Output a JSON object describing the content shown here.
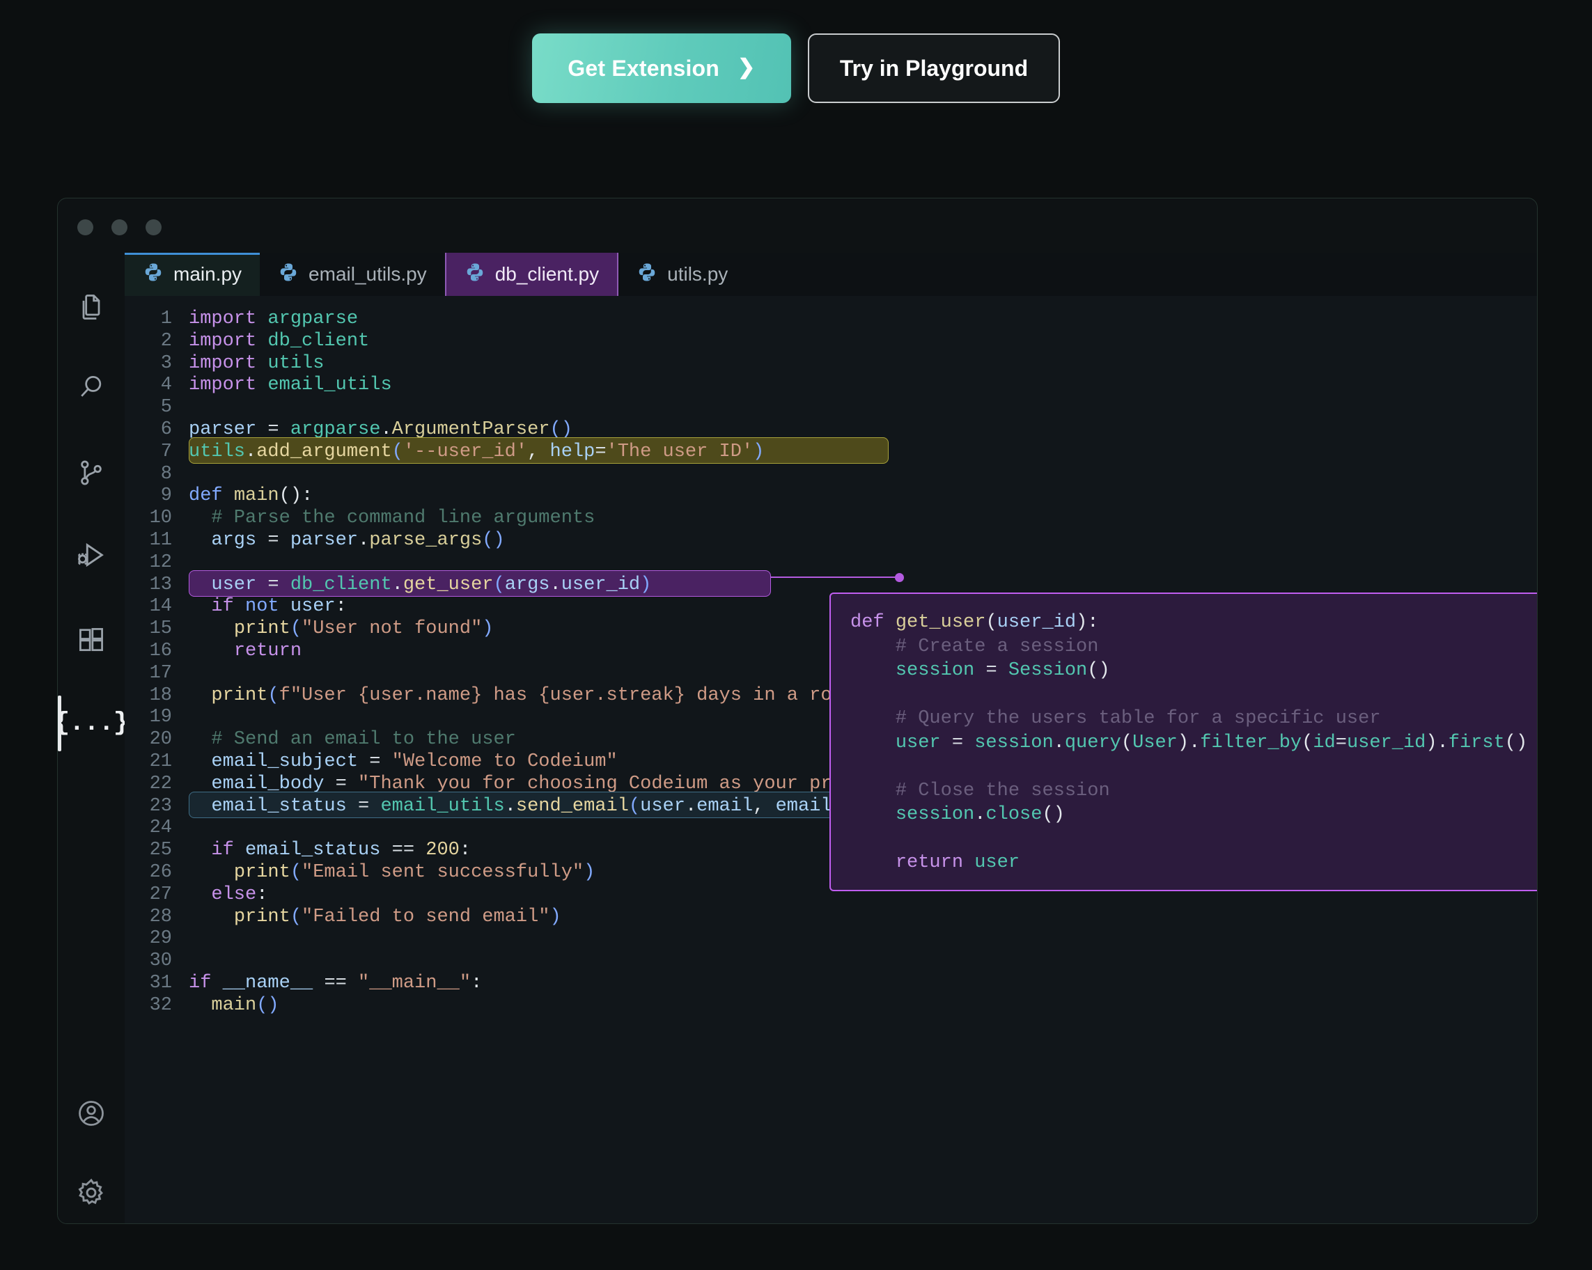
{
  "cta": {
    "primary_label": "Get Extension",
    "primary_chevron": "❯",
    "secondary_label": "Try in Playground",
    "accent": "#5fcbbb"
  },
  "window": {
    "dots": [
      "close-dot",
      "minimize-dot",
      "zoom-dot"
    ],
    "dot_color": "#3d4748",
    "border_color": "#24332e",
    "background": "#0e1214"
  },
  "activity_bar": {
    "items": [
      {
        "name": "explorer",
        "icon": "files-icon",
        "active": false
      },
      {
        "name": "search",
        "icon": "search-icon",
        "active": false
      },
      {
        "name": "source-control",
        "icon": "source-control-icon",
        "active": false
      },
      {
        "name": "run-and-debug",
        "icon": "run-debug-icon",
        "active": false
      },
      {
        "name": "extensions",
        "icon": "extensions-icon",
        "active": false
      },
      {
        "name": "codeium",
        "icon": "braces-icon",
        "glyph": "{...}",
        "active": true
      }
    ],
    "bottom_items": [
      {
        "name": "account",
        "icon": "account-icon"
      },
      {
        "name": "settings",
        "icon": "gear-icon"
      }
    ]
  },
  "tabs": [
    {
      "label": "main.py",
      "icon": "python-icon",
      "state": "active-file"
    },
    {
      "label": "email_utils.py",
      "icon": "python-icon",
      "state": "inactive"
    },
    {
      "label": "db_client.py",
      "icon": "python-icon",
      "state": "highlighted"
    },
    {
      "label": "utils.py",
      "icon": "python-icon",
      "state": "inactive"
    }
  ],
  "editor": {
    "active_file": "main.py",
    "first_line": 1,
    "last_line": 32,
    "lines": [
      {
        "n": "1",
        "text": "import argparse"
      },
      {
        "n": "2",
        "text": "import db_client"
      },
      {
        "n": "3",
        "text": "import utils"
      },
      {
        "n": "4",
        "text": "import email_utils"
      },
      {
        "n": "5",
        "text": ""
      },
      {
        "n": "6",
        "text": "parser = argparse.ArgumentParser()"
      },
      {
        "n": "7",
        "text": "utils.add_argument('--user_id', help='The user ID')",
        "highlight": "olive"
      },
      {
        "n": "8",
        "text": ""
      },
      {
        "n": "9",
        "text": "def main():"
      },
      {
        "n": "10",
        "text": "  # Parse the command line arguments"
      },
      {
        "n": "11",
        "text": "  args = parser.parse_args()"
      },
      {
        "n": "12",
        "text": ""
      },
      {
        "n": "13",
        "text": "  user = db_client.get_user(args.user_id)",
        "highlight": "purple"
      },
      {
        "n": "14",
        "text": "  if not user:"
      },
      {
        "n": "15",
        "text": "    print(\"User not found\")"
      },
      {
        "n": "16",
        "text": "    return"
      },
      {
        "n": "17",
        "text": ""
      },
      {
        "n": "18",
        "text": "  print(f\"User {user.name} has {user.streak} days in a row\")"
      },
      {
        "n": "19",
        "text": ""
      },
      {
        "n": "20",
        "text": "  # Send an email to the user"
      },
      {
        "n": "21",
        "text": "  email_subject = \"Welcome to Codeium\""
      },
      {
        "n": "22",
        "text": "  email_body = \"Thank you for choosing Codeium as your preferred AI development tool!\""
      },
      {
        "n": "23",
        "text": "  email_status = email_utils.send_email(user.email, email_subject, email_body)",
        "highlight": "blue"
      },
      {
        "n": "24",
        "text": ""
      },
      {
        "n": "25",
        "text": "  if email_status == 200:"
      },
      {
        "n": "26",
        "text": "    print(\"Email sent successfully\")"
      },
      {
        "n": "27",
        "text": "  else:"
      },
      {
        "n": "28",
        "text": "    print(\"Failed to send email\")"
      },
      {
        "n": "29",
        "text": ""
      },
      {
        "n": "30",
        "text": ""
      },
      {
        "n": "31",
        "text": "if __name__ == \"__main__\":"
      },
      {
        "n": "32",
        "text": "  main()"
      }
    ]
  },
  "popup": {
    "source_file": "db_client.py",
    "border_color": "#c05ef0",
    "background": "#2c1b3d",
    "lines": [
      "def get_user(user_id):",
      "    # Create a session",
      "    session = Session()",
      "",
      "    # Query the users table for a specific user",
      "    user = session.query(User).filter_by(id=user_id).first()",
      "",
      "    # Close the session",
      "    session.close()",
      "",
      "    return user"
    ]
  }
}
